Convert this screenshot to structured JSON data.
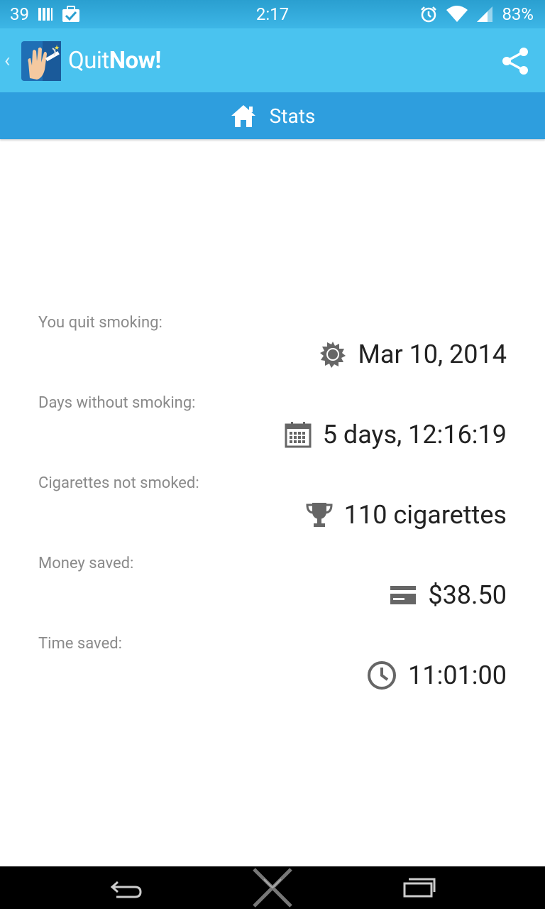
{
  "status_bar": {
    "notification_count": "39",
    "time": "2:17",
    "battery": "83%"
  },
  "action_bar": {
    "title_light": "Quit",
    "title_bold": "Now!"
  },
  "tabs": {
    "active_label": "Stats"
  },
  "stats": [
    {
      "label": "You quit smoking:",
      "value": "Mar 10, 2014",
      "icon": "sun-icon"
    },
    {
      "label": "Days without smoking:",
      "value": "5 days, 12:16:19",
      "icon": "calendar-icon"
    },
    {
      "label": "Cigarettes not smoked:",
      "value": "110 cigarettes",
      "icon": "trophy-icon"
    },
    {
      "label": "Money saved:",
      "value": "$38.50",
      "icon": "credit-card-icon"
    },
    {
      "label": "Time saved:",
      "value": "11:01:00",
      "icon": "clock-icon"
    }
  ],
  "colors": {
    "status_bar": "#3db6e6",
    "action_bar": "#4ac3ef",
    "tab_bar": "#2e9ede",
    "nav_bar": "#000000"
  }
}
